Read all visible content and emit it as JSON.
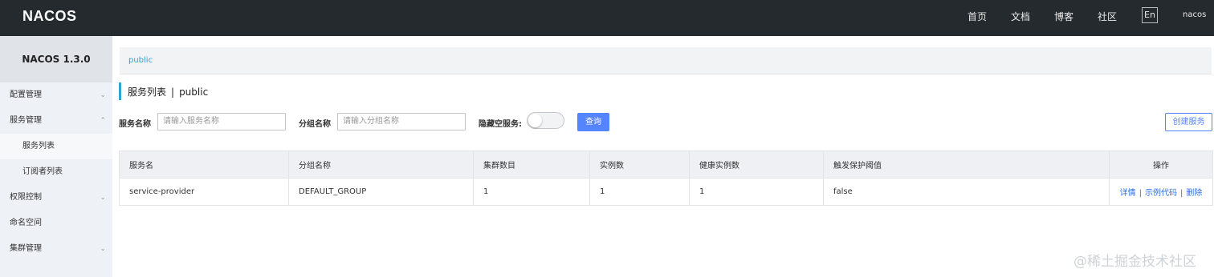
{
  "topbar": {
    "logo": "NACOS",
    "nav": [
      "首页",
      "文档",
      "博客",
      "社区"
    ],
    "lang": "En",
    "user": "nacos"
  },
  "sidebar": {
    "title": "NACOS 1.3.0",
    "items": [
      {
        "label": "配置管理",
        "chevron": "v"
      },
      {
        "label": "服务管理",
        "chevron": "^"
      },
      {
        "label": "服务列表",
        "chevron": ""
      },
      {
        "label": "订阅者列表",
        "chevron": ""
      },
      {
        "label": "权限控制",
        "chevron": "v"
      },
      {
        "label": "命名空间",
        "chevron": ""
      },
      {
        "label": "集群管理",
        "chevron": "v"
      }
    ]
  },
  "breadcrumb": "public",
  "page_title": {
    "main": "服务列表",
    "sep": "|",
    "namespace": "public"
  },
  "filters": {
    "service_name_label": "服务名称",
    "service_name_placeholder": "请输入服务名称",
    "group_name_label": "分组名称",
    "group_name_placeholder": "请输入分组名称",
    "hide_empty_label": "隐藏空服务:",
    "hide_empty_on": false,
    "query_button": "查询",
    "create_button": "创建服务"
  },
  "table": {
    "headers": [
      "服务名",
      "分组名称",
      "集群数目",
      "实例数",
      "健康实例数",
      "触发保护阈值",
      "操作"
    ],
    "rows": [
      {
        "service": "service-provider",
        "group": "DEFAULT_GROUP",
        "clusters": "1",
        "instances": "1",
        "healthy": "1",
        "threshold": "false",
        "actions": [
          "详情",
          "示例代码",
          "删除"
        ]
      }
    ]
  },
  "watermark": "@稀土掘金技术社区",
  "colors": {
    "topbar": "#252a2f",
    "accent": "#2fa3d3",
    "primary": "#5584ff"
  }
}
